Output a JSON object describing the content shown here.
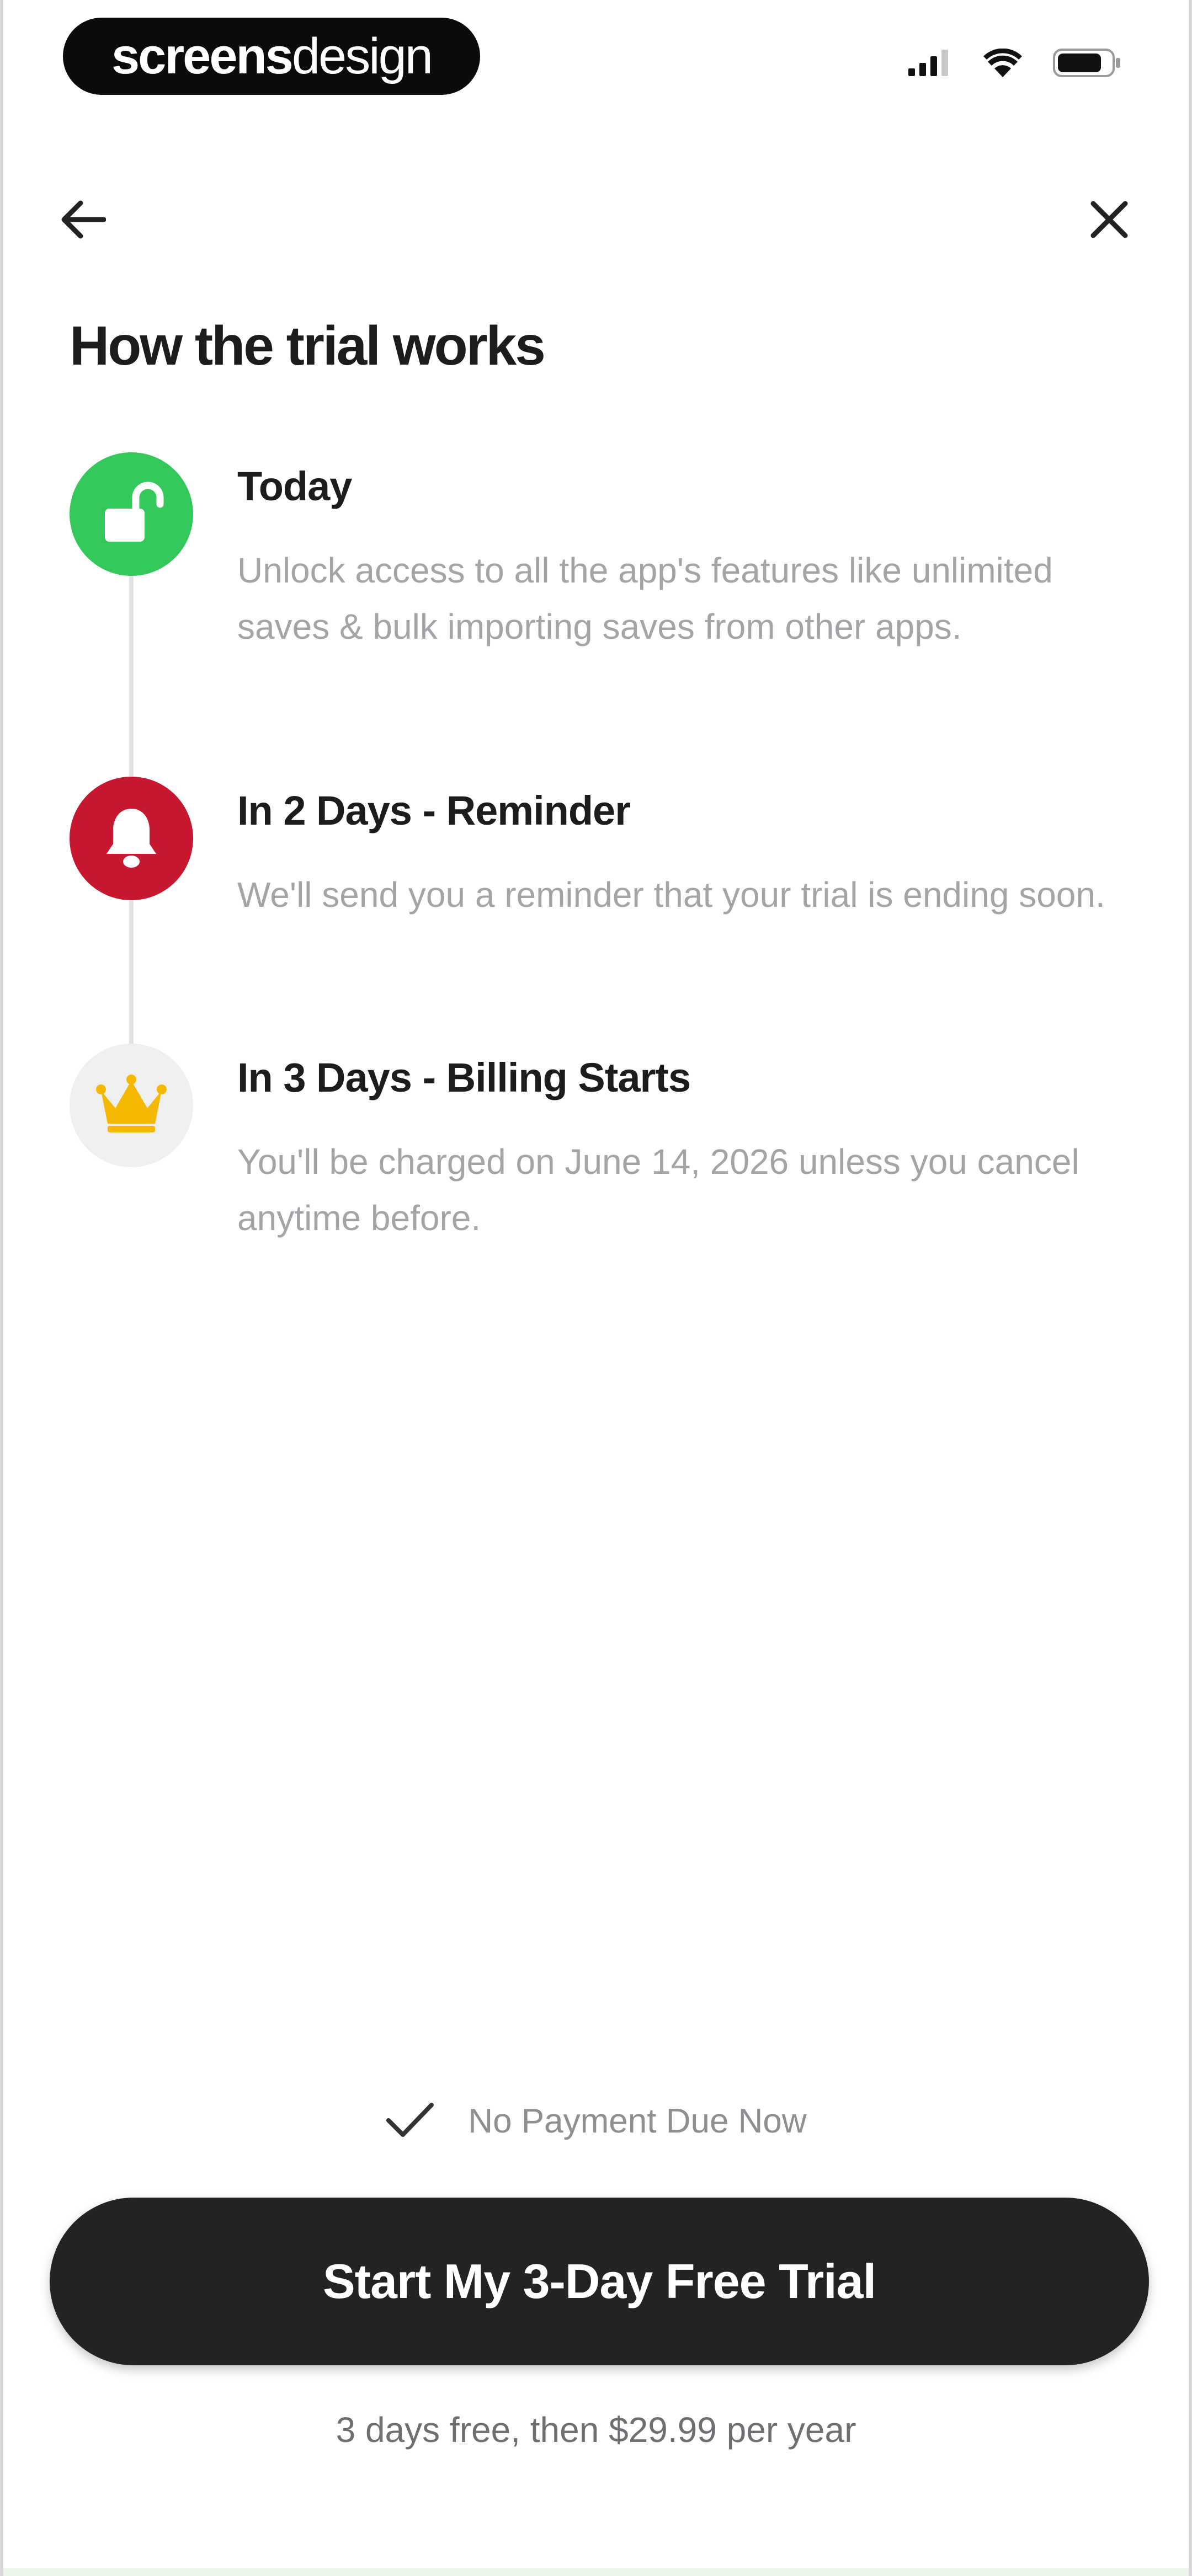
{
  "status_bar": {
    "brand_part1": "screens",
    "brand_part2": "design",
    "icons": [
      "cellular-signal-icon",
      "wifi-icon",
      "battery-icon"
    ]
  },
  "nav": {
    "back_icon": "arrow-left-icon",
    "close_icon": "close-icon"
  },
  "page": {
    "title": "How the trial works"
  },
  "timeline": {
    "steps": [
      {
        "title": "Today",
        "description": "Unlock access to all the app's features like unlimited saves & bulk importing saves from other apps.",
        "icon": "unlock-icon",
        "color": "#34c759"
      },
      {
        "title": "In 2 Days - Reminder",
        "description": "We'll send you a reminder that your trial is ending soon.",
        "icon": "bell-icon",
        "color": "#c7182f"
      },
      {
        "title": "In 3 Days - Billing Starts",
        "description": "You'll be charged on June 14, 2026 unless you cancel anytime before.",
        "icon": "crown-icon",
        "color": "#f5b800"
      }
    ]
  },
  "footer": {
    "no_payment_text": "No Payment Due Now",
    "cta_label": "Start My 3-Day Free Trial",
    "pricing_note": "3 days free, then $29.99 per year"
  },
  "colors": {
    "accent_dark": "#232323",
    "success_green": "#34c759",
    "alert_red": "#c7182f",
    "crown_gold": "#f5b800"
  }
}
